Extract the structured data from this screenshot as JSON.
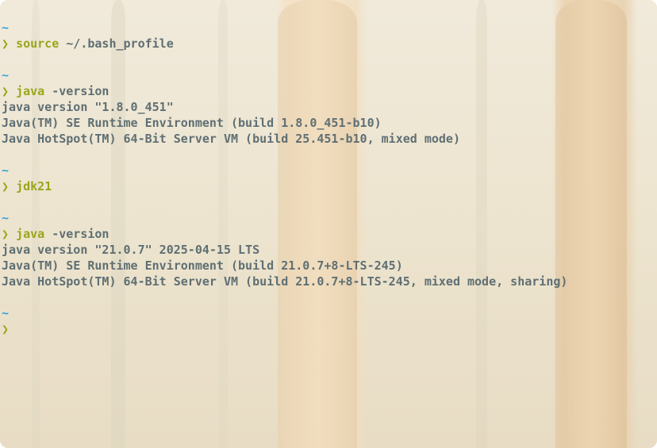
{
  "terminal": {
    "blocks": [
      {
        "cwd": "~",
        "prompt": "❯",
        "command": "source",
        "args": " ~/.bash_profile",
        "output": []
      },
      {
        "cwd": "~",
        "prompt": "❯",
        "command": "java",
        "args": " -version",
        "output": [
          "java version \"1.8.0_451\"",
          "Java(TM) SE Runtime Environment (build 1.8.0_451-b10)",
          "Java HotSpot(TM) 64-Bit Server VM (build 25.451-b10, mixed mode)"
        ]
      },
      {
        "cwd": "~",
        "prompt": "❯",
        "command": "jdk21",
        "args": "",
        "output": []
      },
      {
        "cwd": "~",
        "prompt": "❯",
        "command": "java",
        "args": " -version",
        "output": [
          "java version \"21.0.7\" 2025-04-15 LTS",
          "Java(TM) SE Runtime Environment (build 21.0.7+8-LTS-245)",
          "Java HotSpot(TM) 64-Bit Server VM (build 21.0.7+8-LTS-245, mixed mode, sharing)"
        ]
      }
    ],
    "current": {
      "cwd": "~",
      "prompt": "❯"
    }
  },
  "colors": {
    "cwd": "#36a3d9",
    "prompt": "#9aa61a",
    "text": "#5f6f73"
  }
}
